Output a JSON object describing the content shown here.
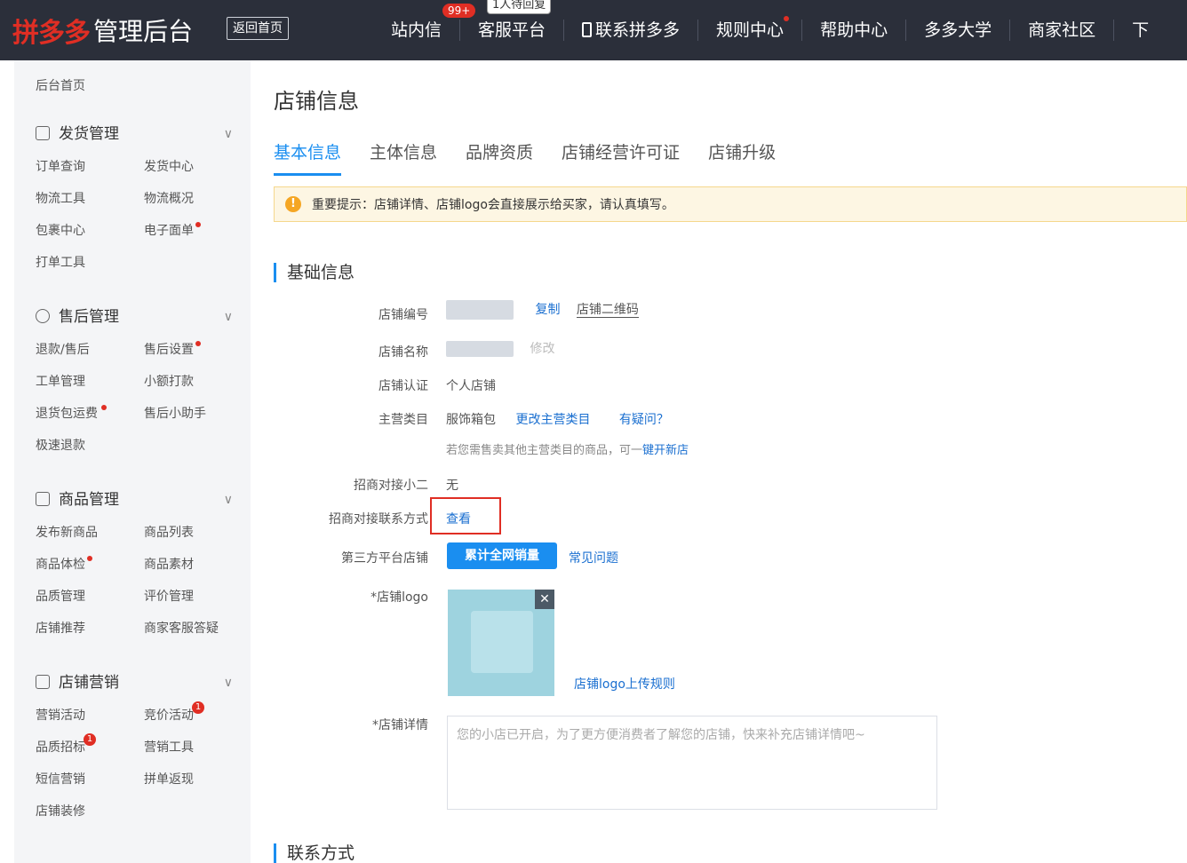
{
  "header": {
    "brand": "拼多多",
    "title": "管理后台",
    "back_home": "返回首页",
    "nav": [
      {
        "label": "站内信",
        "badge": "99+"
      },
      {
        "label": "客服平台",
        "bubble": "1人待回复"
      },
      {
        "label": "联系拼多多",
        "icon": "phone-icon"
      },
      {
        "label": "规则中心",
        "dot": true
      },
      {
        "label": "帮助中心"
      },
      {
        "label": "多多大学"
      },
      {
        "label": "商家社区"
      },
      {
        "label": "下"
      }
    ]
  },
  "sidebar": {
    "home": "后台首页",
    "groups": [
      {
        "title": "发货管理",
        "icon": "document-icon",
        "items": [
          "订单查询",
          "发货中心",
          "物流工具",
          "物流概况",
          "包裹中心",
          "电子面单",
          "打单工具"
        ]
      },
      {
        "title": "售后管理",
        "icon": "shield-check-icon",
        "items": [
          "退款/售后",
          "售后设置",
          "工单管理",
          "小额打款",
          "退货包运费",
          "售后小助手",
          "极速退款"
        ]
      },
      {
        "title": "商品管理",
        "icon": "goods-icon",
        "items": [
          "发布新商品",
          "商品列表",
          "商品体检",
          "商品素材",
          "品质管理",
          "评价管理",
          "店铺推荐",
          "商家客服答疑"
        ]
      },
      {
        "title": "店铺营销",
        "icon": "shop-icon",
        "items": [
          "营销活动",
          "竞价活动",
          "品质招标",
          "营销工具",
          "短信营销",
          "拼单返现",
          "店铺装修"
        ],
        "badges": {
          "竞价活动": "1",
          "品质招标": "1"
        }
      }
    ]
  },
  "main": {
    "page_title": "店铺信息",
    "tabs": [
      "基本信息",
      "主体信息",
      "品牌资质",
      "店铺经营许可证",
      "店铺升级"
    ],
    "active_tab": "基本信息",
    "notice": "重要提示：店铺详情、店铺logo会直接展示给买家，请认真填写。",
    "section_basic": "基础信息",
    "section_contact": "联系方式",
    "fields": {
      "shop_id_label": "店铺编号",
      "copy_link": "复制",
      "qrcode_link": "店铺二维码",
      "shop_name_label": "店铺名称",
      "modify_link": "修改",
      "cert_label": "店铺认证",
      "cert_value": "个人店铺",
      "category_label": "主营类目",
      "category_value": "服饰箱包",
      "change_category": "更改主营类目",
      "question_link": "有疑问？",
      "category_hint_prefix": "若您需售卖其他主营类目的商品，可一",
      "category_hint_link": "键开新店",
      "contact_person_label": "招商对接小二",
      "contact_person_value": "无",
      "contact_method_label": "招商对接联系方式",
      "contact_method_link": "查看",
      "third_party_label": "第三方平台店铺",
      "third_party_button": "累计全网销量",
      "faq_link": "常见问题",
      "logo_label": "*店铺logo",
      "logo_rule_link": "店铺logo上传规则",
      "detail_label": "*店铺详情",
      "detail_placeholder": "您的小店已开启，为了更方便消费者了解您的店铺，快来补充店铺详情吧~"
    }
  }
}
